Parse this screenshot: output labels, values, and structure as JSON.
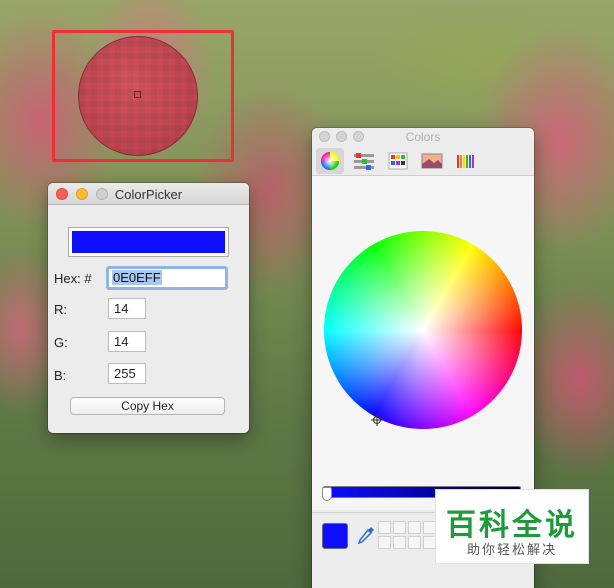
{
  "color_picker": {
    "title": "ColorPicker",
    "swatch_color": "#0E0EFF",
    "hex_label": "Hex: #",
    "hex_value": "0E0EFF",
    "r_label": "R:",
    "r_value": "14",
    "g_label": "G:",
    "g_value": "14",
    "b_label": "B:",
    "b_value": "255",
    "copy_button": "Copy Hex"
  },
  "colors_panel": {
    "title": "Colors",
    "tabs": [
      "color-wheel",
      "color-sliders",
      "color-palettes",
      "image-palettes",
      "pencils"
    ],
    "active_tab": "color-wheel",
    "current_color": "#0E0EFF"
  },
  "magnifier": {
    "frame_color": "#ee2e38",
    "sampled_color": "#c24c57"
  },
  "watermark": {
    "main": "百科全说",
    "sub": "助你轻松解决"
  }
}
